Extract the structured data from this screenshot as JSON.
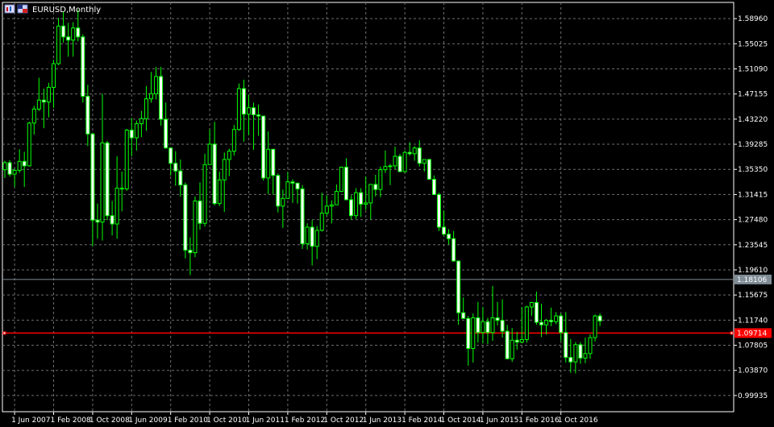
{
  "window": {
    "title": "EURUSD,Monthly"
  },
  "chart_data": {
    "type": "candlestick",
    "symbol": "EURUSD",
    "timeframe": "Monthly",
    "ylim": [
      0.974,
      1.615
    ],
    "y_ticks": [
      "1.58960",
      "1.55025",
      "1.51090",
      "1.47155",
      "1.43220",
      "1.39285",
      "1.35350",
      "1.31415",
      "1.27480",
      "1.23545",
      "1.19610",
      "1.15675",
      "1.11740",
      "1.07805",
      "1.03870",
      "0.99935"
    ],
    "x_ticks": [
      "1 Jun 2007",
      "1 Feb 2008",
      "1 Oct 2008",
      "1 Jun 2009",
      "1 Feb 2010",
      "1 Oct 2010",
      "1 Jun 2011",
      "1 Feb 2012",
      "1 Oct 2012",
      "1 Jun 2013",
      "1 Feb 2014",
      "1 Oct 2014",
      "1 Jun 2015",
      "1 Feb 2016",
      "1 Oct 2016"
    ],
    "grid": true,
    "colors": {
      "background": "#000000",
      "grid": "#6e6e6e",
      "axis": "#ffffff",
      "bull_body": "#000000",
      "bear_body": "#ffffff",
      "wick": "#00ff00",
      "hline_gray": "#7f8c96",
      "hline_red": "#ff0000"
    },
    "horizontal_lines": [
      {
        "price": 1.18106,
        "label": "1.18106",
        "color": "#7f8c96"
      },
      {
        "price": 1.09714,
        "label": "1.09714",
        "color": "#ff0000"
      }
    ],
    "candles": [
      {
        "date": "2007-04",
        "o": 1.353,
        "h": 1.367,
        "l": 1.34,
        "c": 1.364
      },
      {
        "date": "2007-05",
        "o": 1.364,
        "h": 1.368,
        "l": 1.342,
        "c": 1.346
      },
      {
        "date": "2007-06",
        "o": 1.346,
        "h": 1.355,
        "l": 1.326,
        "c": 1.352
      },
      {
        "date": "2007-07",
        "o": 1.352,
        "h": 1.385,
        "l": 1.348,
        "c": 1.366
      },
      {
        "date": "2007-08",
        "o": 1.366,
        "h": 1.381,
        "l": 1.326,
        "c": 1.359
      },
      {
        "date": "2007-09",
        "o": 1.359,
        "h": 1.428,
        "l": 1.358,
        "c": 1.426
      },
      {
        "date": "2007-10",
        "o": 1.426,
        "h": 1.453,
        "l": 1.408,
        "c": 1.448
      },
      {
        "date": "2007-11",
        "o": 1.448,
        "h": 1.497,
        "l": 1.445,
        "c": 1.462
      },
      {
        "date": "2007-12",
        "o": 1.462,
        "h": 1.48,
        "l": 1.418,
        "c": 1.459
      },
      {
        "date": "2008-01",
        "o": 1.459,
        "h": 1.489,
        "l": 1.435,
        "c": 1.482
      },
      {
        "date": "2008-02",
        "o": 1.482,
        "h": 1.525,
        "l": 1.45,
        "c": 1.519
      },
      {
        "date": "2008-03",
        "o": 1.519,
        "h": 1.591,
        "l": 1.517,
        "c": 1.578
      },
      {
        "date": "2008-04",
        "o": 1.578,
        "h": 1.601,
        "l": 1.552,
        "c": 1.561
      },
      {
        "date": "2008-05",
        "o": 1.561,
        "h": 1.583,
        "l": 1.53,
        "c": 1.556
      },
      {
        "date": "2008-06",
        "o": 1.556,
        "h": 1.584,
        "l": 1.53,
        "c": 1.575
      },
      {
        "date": "2008-07",
        "o": 1.575,
        "h": 1.604,
        "l": 1.554,
        "c": 1.561
      },
      {
        "date": "2008-08",
        "o": 1.561,
        "h": 1.565,
        "l": 1.458,
        "c": 1.468
      },
      {
        "date": "2008-09",
        "o": 1.468,
        "h": 1.486,
        "l": 1.39,
        "c": 1.409
      },
      {
        "date": "2008-10",
        "o": 1.409,
        "h": 1.411,
        "l": 1.233,
        "c": 1.274
      },
      {
        "date": "2008-11",
        "o": 1.274,
        "h": 1.3,
        "l": 1.245,
        "c": 1.271
      },
      {
        "date": "2008-12",
        "o": 1.271,
        "h": 1.472,
        "l": 1.242,
        "c": 1.395
      },
      {
        "date": "2009-01",
        "o": 1.395,
        "h": 1.398,
        "l": 1.274,
        "c": 1.281
      },
      {
        "date": "2009-02",
        "o": 1.281,
        "h": 1.304,
        "l": 1.25,
        "c": 1.268
      },
      {
        "date": "2009-03",
        "o": 1.268,
        "h": 1.374,
        "l": 1.245,
        "c": 1.324
      },
      {
        "date": "2009-04",
        "o": 1.324,
        "h": 1.35,
        "l": 1.288,
        "c": 1.323
      },
      {
        "date": "2009-05",
        "o": 1.323,
        "h": 1.417,
        "l": 1.32,
        "c": 1.415
      },
      {
        "date": "2009-06",
        "o": 1.415,
        "h": 1.434,
        "l": 1.374,
        "c": 1.403
      },
      {
        "date": "2009-07",
        "o": 1.403,
        "h": 1.43,
        "l": 1.383,
        "c": 1.425
      },
      {
        "date": "2009-08",
        "o": 1.425,
        "h": 1.445,
        "l": 1.404,
        "c": 1.433
      },
      {
        "date": "2009-09",
        "o": 1.433,
        "h": 1.484,
        "l": 1.414,
        "c": 1.464
      },
      {
        "date": "2009-10",
        "o": 1.464,
        "h": 1.506,
        "l": 1.458,
        "c": 1.472
      },
      {
        "date": "2009-11",
        "o": 1.472,
        "h": 1.514,
        "l": 1.463,
        "c": 1.499
      },
      {
        "date": "2009-12",
        "o": 1.499,
        "h": 1.514,
        "l": 1.422,
        "c": 1.432
      },
      {
        "date": "2010-01",
        "o": 1.432,
        "h": 1.458,
        "l": 1.386,
        "c": 1.387
      },
      {
        "date": "2010-02",
        "o": 1.387,
        "h": 1.388,
        "l": 1.344,
        "c": 1.363
      },
      {
        "date": "2010-03",
        "o": 1.363,
        "h": 1.382,
        "l": 1.328,
        "c": 1.351
      },
      {
        "date": "2010-04",
        "o": 1.351,
        "h": 1.369,
        "l": 1.311,
        "c": 1.329
      },
      {
        "date": "2010-05",
        "o": 1.329,
        "h": 1.333,
        "l": 1.214,
        "c": 1.227
      },
      {
        "date": "2010-06",
        "o": 1.227,
        "h": 1.247,
        "l": 1.188,
        "c": 1.223
      },
      {
        "date": "2010-07",
        "o": 1.223,
        "h": 1.311,
        "l": 1.216,
        "c": 1.304
      },
      {
        "date": "2010-08",
        "o": 1.304,
        "h": 1.333,
        "l": 1.259,
        "c": 1.269
      },
      {
        "date": "2010-09",
        "o": 1.269,
        "h": 1.378,
        "l": 1.264,
        "c": 1.361
      },
      {
        "date": "2010-10",
        "o": 1.361,
        "h": 1.416,
        "l": 1.37,
        "c": 1.393
      },
      {
        "date": "2010-11",
        "o": 1.393,
        "h": 1.428,
        "l": 1.297,
        "c": 1.3
      },
      {
        "date": "2010-12",
        "o": 1.3,
        "h": 1.35,
        "l": 1.296,
        "c": 1.337
      },
      {
        "date": "2011-01",
        "o": 1.337,
        "h": 1.38,
        "l": 1.287,
        "c": 1.369
      },
      {
        "date": "2011-02",
        "o": 1.369,
        "h": 1.386,
        "l": 1.343,
        "c": 1.382
      },
      {
        "date": "2011-03",
        "o": 1.382,
        "h": 1.423,
        "l": 1.375,
        "c": 1.416
      },
      {
        "date": "2011-04",
        "o": 1.416,
        "h": 1.488,
        "l": 1.414,
        "c": 1.48
      },
      {
        "date": "2011-05",
        "o": 1.48,
        "h": 1.494,
        "l": 1.397,
        "c": 1.44
      },
      {
        "date": "2011-06",
        "o": 1.44,
        "h": 1.47,
        "l": 1.407,
        "c": 1.45
      },
      {
        "date": "2011-07",
        "o": 1.45,
        "h": 1.458,
        "l": 1.384,
        "c": 1.439
      },
      {
        "date": "2011-08",
        "o": 1.439,
        "h": 1.455,
        "l": 1.406,
        "c": 1.437
      },
      {
        "date": "2011-09",
        "o": 1.437,
        "h": 1.436,
        "l": 1.336,
        "c": 1.34
      },
      {
        "date": "2011-10",
        "o": 1.34,
        "h": 1.413,
        "l": 1.315,
        "c": 1.385
      },
      {
        "date": "2011-11",
        "o": 1.385,
        "h": 1.384,
        "l": 1.314,
        "c": 1.344
      },
      {
        "date": "2011-12",
        "o": 1.344,
        "h": 1.347,
        "l": 1.286,
        "c": 1.296
      },
      {
        "date": "2012-01",
        "o": 1.296,
        "h": 1.322,
        "l": 1.262,
        "c": 1.308
      },
      {
        "date": "2012-02",
        "o": 1.308,
        "h": 1.349,
        "l": 1.307,
        "c": 1.334
      },
      {
        "date": "2012-03",
        "o": 1.334,
        "h": 1.338,
        "l": 1.301,
        "c": 1.332
      },
      {
        "date": "2012-04",
        "o": 1.332,
        "h": 1.328,
        "l": 1.3,
        "c": 1.323
      },
      {
        "date": "2012-05",
        "o": 1.323,
        "h": 1.329,
        "l": 1.229,
        "c": 1.237
      },
      {
        "date": "2012-06",
        "o": 1.237,
        "h": 1.269,
        "l": 1.228,
        "c": 1.263
      },
      {
        "date": "2012-07",
        "o": 1.263,
        "h": 1.274,
        "l": 1.203,
        "c": 1.233
      },
      {
        "date": "2012-08",
        "o": 1.233,
        "h": 1.265,
        "l": 1.213,
        "c": 1.258
      },
      {
        "date": "2012-09",
        "o": 1.258,
        "h": 1.317,
        "l": 1.256,
        "c": 1.285
      },
      {
        "date": "2012-10",
        "o": 1.285,
        "h": 1.313,
        "l": 1.281,
        "c": 1.296
      },
      {
        "date": "2012-11",
        "o": 1.296,
        "h": 1.305,
        "l": 1.269,
        "c": 1.298
      },
      {
        "date": "2012-12",
        "o": 1.298,
        "h": 1.33,
        "l": 1.299,
        "c": 1.319
      },
      {
        "date": "2013-01",
        "o": 1.319,
        "h": 1.358,
        "l": 1.318,
        "c": 1.357
      },
      {
        "date": "2013-02",
        "o": 1.357,
        "h": 1.371,
        "l": 1.305,
        "c": 1.306
      },
      {
        "date": "2013-03",
        "o": 1.306,
        "h": 1.313,
        "l": 1.275,
        "c": 1.281
      },
      {
        "date": "2013-04",
        "o": 1.281,
        "h": 1.324,
        "l": 1.276,
        "c": 1.317
      },
      {
        "date": "2013-05",
        "o": 1.317,
        "h": 1.324,
        "l": 1.279,
        "c": 1.299
      },
      {
        "date": "2013-06",
        "o": 1.299,
        "h": 1.342,
        "l": 1.29,
        "c": 1.301
      },
      {
        "date": "2013-07",
        "o": 1.301,
        "h": 1.33,
        "l": 1.275,
        "c": 1.33
      },
      {
        "date": "2013-08",
        "o": 1.33,
        "h": 1.345,
        "l": 1.311,
        "c": 1.322
      },
      {
        "date": "2013-09",
        "o": 1.322,
        "h": 1.358,
        "l": 1.31,
        "c": 1.353
      },
      {
        "date": "2013-10",
        "o": 1.353,
        "h": 1.383,
        "l": 1.348,
        "c": 1.358
      },
      {
        "date": "2013-11",
        "o": 1.358,
        "h": 1.362,
        "l": 1.329,
        "c": 1.359
      },
      {
        "date": "2013-12",
        "o": 1.359,
        "h": 1.389,
        "l": 1.354,
        "c": 1.374
      },
      {
        "date": "2014-01",
        "o": 1.374,
        "h": 1.378,
        "l": 1.351,
        "c": 1.35
      },
      {
        "date": "2014-02",
        "o": 1.35,
        "h": 1.383,
        "l": 1.348,
        "c": 1.38
      },
      {
        "date": "2014-03",
        "o": 1.38,
        "h": 1.396,
        "l": 1.375,
        "c": 1.378
      },
      {
        "date": "2014-04",
        "o": 1.378,
        "h": 1.39,
        "l": 1.367,
        "c": 1.387
      },
      {
        "date": "2014-05",
        "o": 1.387,
        "h": 1.399,
        "l": 1.358,
        "c": 1.363
      },
      {
        "date": "2014-06",
        "o": 1.363,
        "h": 1.369,
        "l": 1.35,
        "c": 1.369
      },
      {
        "date": "2014-07",
        "o": 1.369,
        "h": 1.37,
        "l": 1.338,
        "c": 1.338
      },
      {
        "date": "2014-08",
        "o": 1.338,
        "h": 1.344,
        "l": 1.314,
        "c": 1.314
      },
      {
        "date": "2014-09",
        "o": 1.314,
        "h": 1.317,
        "l": 1.257,
        "c": 1.263
      },
      {
        "date": "2014-10",
        "o": 1.263,
        "h": 1.289,
        "l": 1.25,
        "c": 1.252
      },
      {
        "date": "2014-11",
        "o": 1.252,
        "h": 1.26,
        "l": 1.236,
        "c": 1.245
      },
      {
        "date": "2014-12",
        "o": 1.245,
        "h": 1.257,
        "l": 1.209,
        "c": 1.21
      },
      {
        "date": "2015-01",
        "o": 1.21,
        "h": 1.21,
        "l": 1.11,
        "c": 1.129
      },
      {
        "date": "2015-02",
        "o": 1.129,
        "h": 1.153,
        "l": 1.126,
        "c": 1.12
      },
      {
        "date": "2015-03",
        "o": 1.12,
        "h": 1.124,
        "l": 1.046,
        "c": 1.073
      },
      {
        "date": "2015-04",
        "o": 1.073,
        "h": 1.128,
        "l": 1.051,
        "c": 1.121
      },
      {
        "date": "2015-05",
        "o": 1.121,
        "h": 1.146,
        "l": 1.082,
        "c": 1.098
      },
      {
        "date": "2015-06",
        "o": 1.098,
        "h": 1.138,
        "l": 1.081,
        "c": 1.115
      },
      {
        "date": "2015-07",
        "o": 1.115,
        "h": 1.121,
        "l": 1.08,
        "c": 1.098
      },
      {
        "date": "2015-08",
        "o": 1.098,
        "h": 1.171,
        "l": 1.085,
        "c": 1.121
      },
      {
        "date": "2015-09",
        "o": 1.121,
        "h": 1.146,
        "l": 1.109,
        "c": 1.117
      },
      {
        "date": "2015-10",
        "o": 1.117,
        "h": 1.15,
        "l": 1.09,
        "c": 1.1
      },
      {
        "date": "2015-11",
        "o": 1.1,
        "h": 1.11,
        "l": 1.056,
        "c": 1.057
      },
      {
        "date": "2015-12",
        "o": 1.057,
        "h": 1.105,
        "l": 1.052,
        "c": 1.086
      },
      {
        "date": "2016-01",
        "o": 1.086,
        "h": 1.099,
        "l": 1.071,
        "c": 1.083
      },
      {
        "date": "2016-02",
        "o": 1.083,
        "h": 1.138,
        "l": 1.081,
        "c": 1.087
      },
      {
        "date": "2016-03",
        "o": 1.087,
        "h": 1.14,
        "l": 1.082,
        "c": 1.138
      },
      {
        "date": "2016-04",
        "o": 1.138,
        "h": 1.146,
        "l": 1.124,
        "c": 1.145
      },
      {
        "date": "2016-05",
        "o": 1.145,
        "h": 1.162,
        "l": 1.11,
        "c": 1.114
      },
      {
        "date": "2016-06",
        "o": 1.114,
        "h": 1.143,
        "l": 1.091,
        "c": 1.11
      },
      {
        "date": "2016-07",
        "o": 1.11,
        "h": 1.119,
        "l": 1.095,
        "c": 1.117
      },
      {
        "date": "2016-08",
        "o": 1.117,
        "h": 1.137,
        "l": 1.108,
        "c": 1.115
      },
      {
        "date": "2016-09",
        "o": 1.115,
        "h": 1.13,
        "l": 1.111,
        "c": 1.124
      },
      {
        "date": "2016-10",
        "o": 1.124,
        "h": 1.128,
        "l": 1.085,
        "c": 1.098
      },
      {
        "date": "2016-11",
        "o": 1.098,
        "h": 1.13,
        "l": 1.051,
        "c": 1.059
      },
      {
        "date": "2016-12",
        "o": 1.059,
        "h": 1.088,
        "l": 1.035,
        "c": 1.052
      },
      {
        "date": "2017-01",
        "o": 1.052,
        "h": 1.083,
        "l": 1.034,
        "c": 1.079
      },
      {
        "date": "2017-02",
        "o": 1.079,
        "h": 1.083,
        "l": 1.049,
        "c": 1.058
      },
      {
        "date": "2017-03",
        "o": 1.058,
        "h": 1.09,
        "l": 1.05,
        "c": 1.065
      },
      {
        "date": "2017-04",
        "o": 1.065,
        "h": 1.095,
        "l": 1.057,
        "c": 1.09
      },
      {
        "date": "2017-05",
        "o": 1.09,
        "h": 1.126,
        "l": 1.084,
        "c": 1.124
      },
      {
        "date": "2017-06",
        "o": 1.124,
        "h": 1.128,
        "l": 1.108,
        "c": 1.116
      }
    ]
  }
}
